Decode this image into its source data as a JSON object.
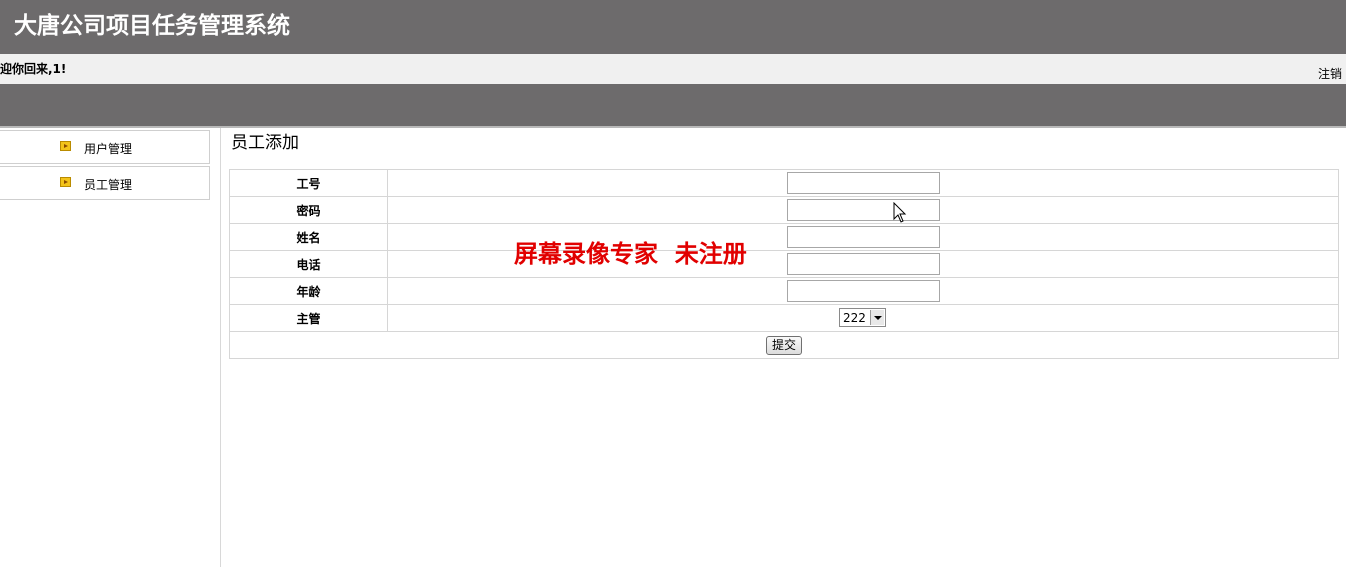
{
  "header": {
    "app_title": "大唐公司项目任务管理系统"
  },
  "welcome_bar": {
    "welcome_text": "迎你回来,1!",
    "logout_label": "注销"
  },
  "sidebar": {
    "items": [
      {
        "label": "用户管理",
        "icon": "arrow-right-icon"
      },
      {
        "label": "员工管理",
        "icon": "arrow-right-icon"
      }
    ]
  },
  "main": {
    "page_title": "员工添加",
    "fields": [
      {
        "label": "工号",
        "value": ""
      },
      {
        "label": "密码",
        "value": ""
      },
      {
        "label": "姓名",
        "value": ""
      },
      {
        "label": "电话",
        "value": ""
      },
      {
        "label": "年龄",
        "value": ""
      }
    ],
    "supervisor": {
      "label": "主管",
      "selected": "222"
    },
    "submit_label": "提交"
  },
  "watermark": {
    "text": "屏幕录像专家  未注册"
  },
  "colors": {
    "header_bg": "#6d6b6c",
    "welcome_bg": "#f0f0f0",
    "watermark": "#e10000"
  }
}
